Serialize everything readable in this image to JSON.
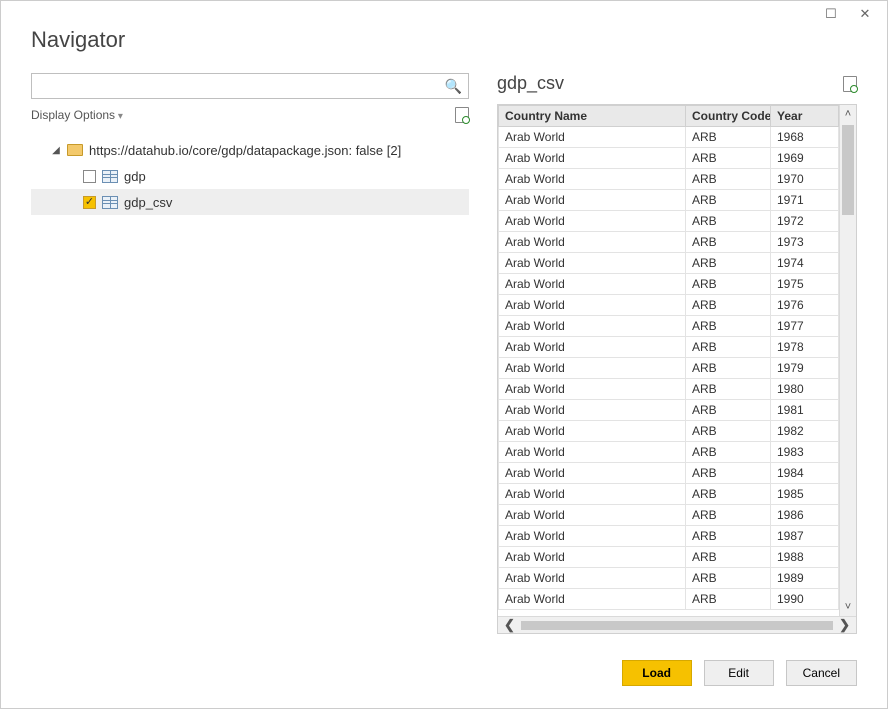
{
  "window": {
    "title": "Navigator"
  },
  "search": {
    "placeholder": ""
  },
  "options": {
    "display_label": "Display Options"
  },
  "tree": {
    "root_label": "https://datahub.io/core/gdp/datapackage.json: false [2]",
    "items": [
      {
        "label": "gdp",
        "checked": false
      },
      {
        "label": "gdp_csv",
        "checked": true
      }
    ]
  },
  "preview": {
    "title": "gdp_csv",
    "columns": [
      "Country Name",
      "Country Code",
      "Year"
    ],
    "rows": [
      [
        "Arab World",
        "ARB",
        "1968"
      ],
      [
        "Arab World",
        "ARB",
        "1969"
      ],
      [
        "Arab World",
        "ARB",
        "1970"
      ],
      [
        "Arab World",
        "ARB",
        "1971"
      ],
      [
        "Arab World",
        "ARB",
        "1972"
      ],
      [
        "Arab World",
        "ARB",
        "1973"
      ],
      [
        "Arab World",
        "ARB",
        "1974"
      ],
      [
        "Arab World",
        "ARB",
        "1975"
      ],
      [
        "Arab World",
        "ARB",
        "1976"
      ],
      [
        "Arab World",
        "ARB",
        "1977"
      ],
      [
        "Arab World",
        "ARB",
        "1978"
      ],
      [
        "Arab World",
        "ARB",
        "1979"
      ],
      [
        "Arab World",
        "ARB",
        "1980"
      ],
      [
        "Arab World",
        "ARB",
        "1981"
      ],
      [
        "Arab World",
        "ARB",
        "1982"
      ],
      [
        "Arab World",
        "ARB",
        "1983"
      ],
      [
        "Arab World",
        "ARB",
        "1984"
      ],
      [
        "Arab World",
        "ARB",
        "1985"
      ],
      [
        "Arab World",
        "ARB",
        "1986"
      ],
      [
        "Arab World",
        "ARB",
        "1987"
      ],
      [
        "Arab World",
        "ARB",
        "1988"
      ],
      [
        "Arab World",
        "ARB",
        "1989"
      ],
      [
        "Arab World",
        "ARB",
        "1990"
      ]
    ]
  },
  "footer": {
    "load": "Load",
    "edit": "Edit",
    "cancel": "Cancel"
  }
}
